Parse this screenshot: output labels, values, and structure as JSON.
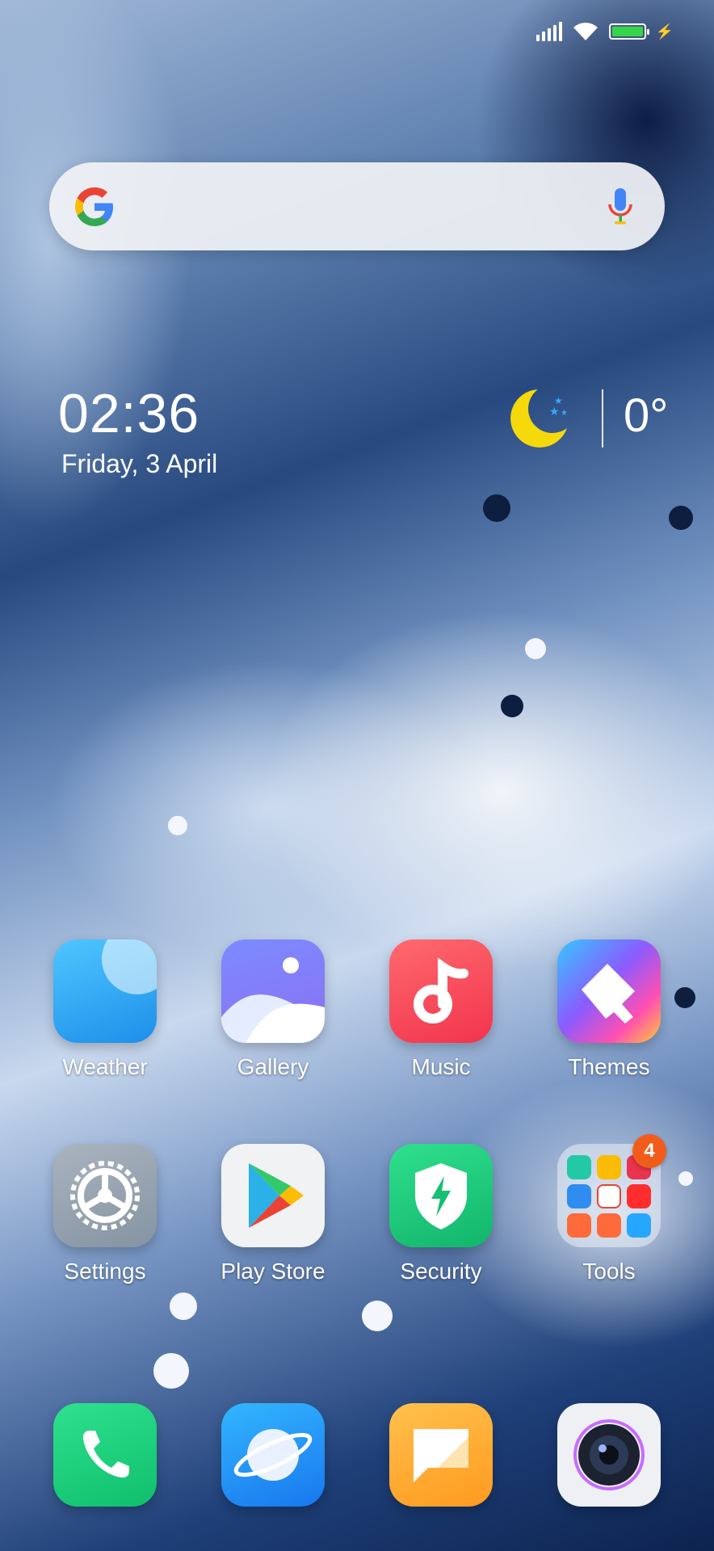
{
  "status_bar": {
    "signal_icon": "signal-icon",
    "wifi_icon": "wifi-icon",
    "battery_icon": "battery-icon",
    "battery_level": 1.0,
    "charging_icon": "charging-icon"
  },
  "search_bar": {
    "logo_icon": "google-g-icon",
    "mic_icon": "mic-icon"
  },
  "clock": {
    "time": "02:36",
    "date": "Friday, 3 April"
  },
  "weather": {
    "icon": "moon-icon",
    "temperature": "0°"
  },
  "apps_row1": [
    {
      "label": "Weather",
      "icon": "weather-icon"
    },
    {
      "label": "Gallery",
      "icon": "gallery-icon"
    },
    {
      "label": "Music",
      "icon": "music-icon"
    },
    {
      "label": "Themes",
      "icon": "themes-icon"
    }
  ],
  "apps_row2": [
    {
      "label": "Settings",
      "icon": "settings-icon"
    },
    {
      "label": "Play Store",
      "icon": "play-store-icon"
    },
    {
      "label": "Security",
      "icon": "security-icon"
    },
    {
      "label": "Tools",
      "icon": "tools-folder-icon",
      "badge": "4"
    }
  ],
  "dock": [
    {
      "icon": "phone-icon"
    },
    {
      "icon": "browser-icon"
    },
    {
      "icon": "messages-icon"
    },
    {
      "icon": "camera-icon"
    }
  ]
}
